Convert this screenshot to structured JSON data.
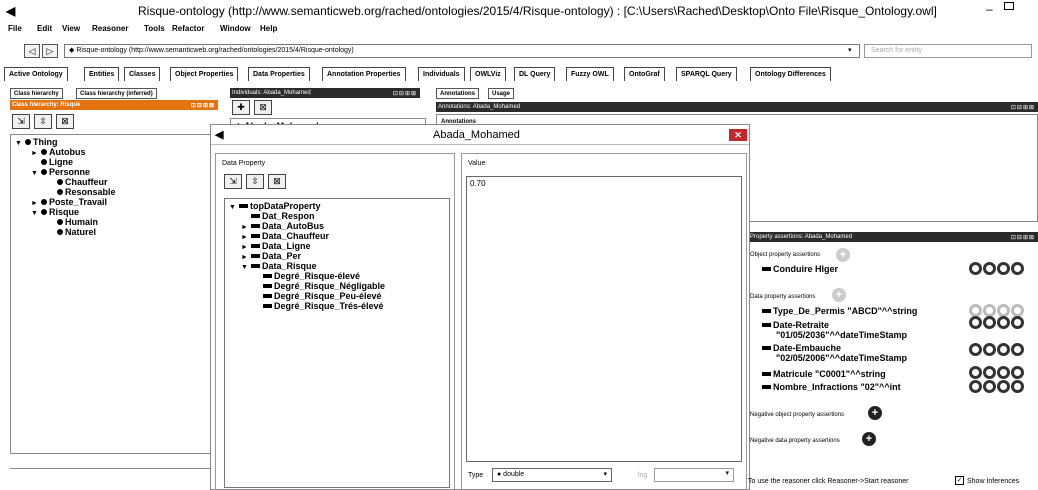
{
  "window": {
    "logo": "◀",
    "title": "Risque-ontology (http://www.semanticweb.org/rached/ontologies/2015/4/Risque-ontology)  : [C:\\Users\\Rached\\Desktop\\Onto File\\Risque_Ontology.owl]",
    "min": "–"
  },
  "menu": [
    "File",
    "Edit",
    "View",
    "Reasoner",
    "Tools",
    "Refactor",
    "Window",
    "Help"
  ],
  "nav": {
    "back": "◁",
    "forward": "▷",
    "url": "◆ Risque-ontology (http://www.semanticweb.org/rached/ontologies/2015/4/Risque-ontology)",
    "dropdown": "▾",
    "search_placeholder": "Search for entity"
  },
  "tabs": [
    "Active Ontology",
    "Entities",
    "Classes",
    "Object Properties",
    "Data Properties",
    "Annotation Properties",
    "Individuals",
    "OWLViz",
    "DL Query",
    "Fuzzy OWL",
    "OntoGraf",
    "SPARQL Query",
    "Ontology Differences"
  ],
  "left": {
    "subtabs": [
      "Class hierarchy",
      "Class hierarchy (inferred)"
    ],
    "header": "Class hierarchy: Risque",
    "ctrls": "⊡⊟⊞⊠",
    "tools": [
      "⇲",
      "⇳",
      "⊠"
    ],
    "tree": [
      {
        "arrow": "▼",
        "label": "Thing"
      },
      {
        "arrow": "►",
        "label": "Autobus"
      },
      {
        "arrow": "",
        "label": "Ligne"
      },
      {
        "arrow": "▼",
        "label": "Personne"
      },
      {
        "arrow": "",
        "label": "Chauffeur"
      },
      {
        "arrow": "",
        "label": "Resonsable"
      },
      {
        "arrow": "►",
        "label": "Poste_Travail"
      },
      {
        "arrow": "▼",
        "label": "Risque"
      },
      {
        "arrow": "",
        "label": "Humain"
      },
      {
        "arrow": "",
        "label": "Naturel"
      }
    ]
  },
  "individuals": {
    "header": "Individuals: Abada_Mohamed",
    "ctrls": "⊡⊟⊞⊠",
    "tools": [
      "✚",
      "⊠"
    ],
    "item": "◆ Abada_Mohamed"
  },
  "annotations": {
    "subtabs": [
      "Annotations",
      "Usage"
    ],
    "header": "Annotations: Abada_Mohamed",
    "ctrls": "⊡⊟⊞⊠",
    "body_label": "Annotations"
  },
  "props": {
    "header": "Property assertions: Abada_Mohamed",
    "ctrls": "⊡⊟⊞⊠",
    "object_label": "Object property assertions",
    "object_items": [
      "Conduire  Hlger"
    ],
    "data_label": "Data property assertions",
    "data_items": [
      "Type_De_Permis  \"ABCD\"^^string",
      "Date-Retraite",
      "\"01/05/2036\"^^dateTimeStamp",
      "Date-Embauche",
      "\"02/05/2006\"^^dateTimeStamp",
      "Matricule  \"C0001\"^^string",
      "Nombre_Infractions  \"02\"^^int"
    ],
    "neg_object": "Negative object property assertions",
    "neg_data": "Negative data property assertions",
    "plus": "+"
  },
  "dialog": {
    "logo": "◀",
    "title": "Abada_Mohamed",
    "close": "✕",
    "dp_label": "Data Property",
    "dp_tools": [
      "⇲",
      "⇳",
      "⊠"
    ],
    "tree": [
      {
        "arrow": "▼",
        "label": "topDataProperty"
      },
      {
        "arrow": "",
        "label": "Dat_Respon"
      },
      {
        "arrow": "►",
        "label": "Data_AutoBus"
      },
      {
        "arrow": "►",
        "label": "Data_Chauffeur"
      },
      {
        "arrow": "►",
        "label": "Data_Ligne"
      },
      {
        "arrow": "►",
        "label": "Data_Per"
      },
      {
        "arrow": "▼",
        "label": "Data_Risque"
      },
      {
        "arrow": "",
        "label": "Degré_Risque-élevé"
      },
      {
        "arrow": "",
        "label": "Degré_Risque_Négligable"
      },
      {
        "arrow": "",
        "label": "Degré_Risque_Peu-élevé"
      },
      {
        "arrow": "",
        "label": "Degré_Risque_Trés-élevé"
      }
    ],
    "value_label": "Value",
    "value": "0.70",
    "type_label": "Type",
    "type_value": "● double",
    "lang_label": "lng"
  },
  "status": {
    "text": "To use the reasoner click Reasoner->Start reasoner",
    "check": "✓",
    "check_label": "Show Inferences"
  }
}
